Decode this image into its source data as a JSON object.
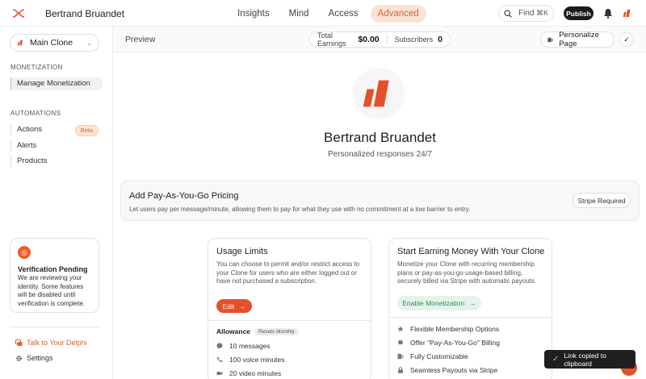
{
  "header": {
    "user_name": "Bertrand Bruandet",
    "nav": [
      "Insights",
      "Mind",
      "Access",
      "Advanced"
    ],
    "active_nav": "Advanced",
    "find_label": "Find",
    "find_shortcut": "⌘K",
    "publish_label": "Publish"
  },
  "sidebar": {
    "clone_select": "Main Clone",
    "monetization_heading": "MONETIZATION",
    "monetization_items": [
      "Manage Monetization"
    ],
    "automations_heading": "AUTOMATIONS",
    "automation_items": [
      "Actions",
      "Alerts",
      "Products"
    ],
    "beta_badge": "Beta",
    "verification": {
      "title": "Verification Pending",
      "text": "We are reviewing your identity. Some features will be disabled until verification is complete."
    },
    "talk_link": "Talk to Your Delphi",
    "settings_link": "Settings"
  },
  "preview": {
    "label": "Preview",
    "total_earnings_label": "Total Earnings",
    "total_earnings_value": "$0.00",
    "subscribers_label": "Subscribers",
    "subscribers_value": "0",
    "personalize_label": "Personalize Page"
  },
  "profile": {
    "name": "Bertrand Bruandet",
    "tagline": "Personalized responses 24/7"
  },
  "payg": {
    "title": "Add Pay-As-You-Go Pricing",
    "description": "Let users pay per message/minute, allowing them to pay for what they use with no commitment at a low barrier to entry.",
    "badge": "Stripe Required"
  },
  "usage_card": {
    "title": "Usage Limits",
    "description": "You can choose to permit and/or restrict access to your Clone for users who are either logged out or have not purchased a subscription.",
    "edit_label": "Edit",
    "allowance_label": "Allowance",
    "resets_label": "Resets Monthly",
    "items": [
      "10 messages",
      "100 voice minutes",
      "20 video minutes"
    ]
  },
  "earn_card": {
    "title": "Start Earning Money With Your Clone",
    "description": "Monetize your Clone with recurring membership plans or pay-as-you-go usage-based billing, securely billed via Stripe with automatic payouts.",
    "enable_label": "Enable Monetization",
    "features": [
      "Flexible Membership Options",
      "Offer \"Pay-As-You-Go\" Billing",
      "Fully Customizable",
      "Seamless Payouts via Stripe"
    ]
  },
  "toast": {
    "message": "Link copied to clipboard"
  },
  "colors": {
    "brand": "#e5502a",
    "accent_bg": "#fbe3d4",
    "success": "#2e8a57"
  }
}
